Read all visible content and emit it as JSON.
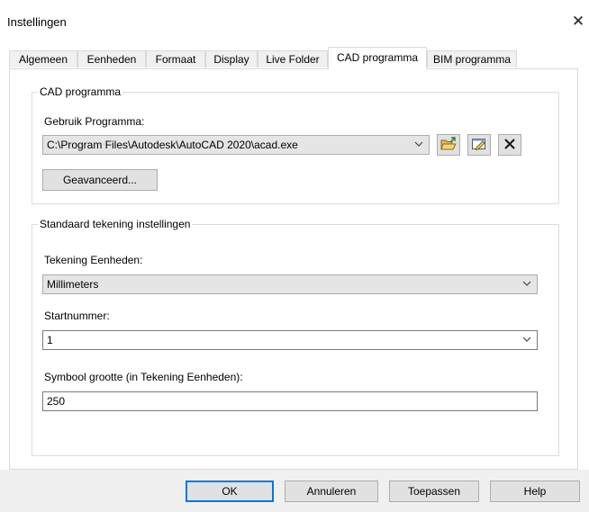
{
  "window": {
    "title": "Instellingen",
    "close_symbol": "✕"
  },
  "tabs": [
    {
      "label": "Algemeen",
      "active": false
    },
    {
      "label": "Eenheden",
      "active": false
    },
    {
      "label": "Formaat",
      "active": false
    },
    {
      "label": "Display",
      "active": false
    },
    {
      "label": "Live Folder",
      "active": false
    },
    {
      "label": "CAD programma",
      "active": true
    },
    {
      "label": "BIM programma",
      "active": false
    }
  ],
  "cad_group": {
    "legend": "CAD programma",
    "program_label": "Gebruik Programma:",
    "program_path": "C:\\Program Files\\Autodesk\\AutoCAD 2020\\acad.exe",
    "advanced_button": "Geavanceerd...",
    "icons": [
      "open-folder-icon",
      "edit-icon",
      "delete-icon"
    ]
  },
  "drawing_group": {
    "legend": "Standaard tekening instellingen",
    "units_label": "Tekening Eenheden:",
    "units_value": "Millimeters",
    "start_label": "Startnummer:",
    "start_value": "1",
    "symbol_label": "Symbool grootte (in Tekening Eenheden):",
    "symbol_value": "250"
  },
  "footer": {
    "ok": "OK",
    "cancel": "Annuleren",
    "apply": "Toepassen",
    "help": "Help"
  },
  "colors": {
    "accent": "#0078d7",
    "button_face": "#e1e1e1",
    "footer_bg": "#f0f0f0"
  }
}
